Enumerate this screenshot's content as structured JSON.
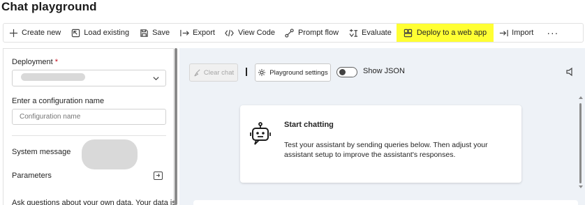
{
  "page": {
    "title": "Chat playground"
  },
  "toolbar": {
    "items": [
      {
        "label": "Create new",
        "icon": "plus-icon"
      },
      {
        "label": "Load existing",
        "icon": "load-icon"
      },
      {
        "label": "Save",
        "icon": "save-icon"
      },
      {
        "label": "Export",
        "icon": "export-icon"
      },
      {
        "label": "View Code",
        "icon": "code-icon"
      },
      {
        "label": "Prompt flow",
        "icon": "flow-icon"
      },
      {
        "label": "Evaluate",
        "icon": "evaluate-icon"
      },
      {
        "label": "Deploy to a web app",
        "icon": "webapp-icon"
      },
      {
        "label": "Import",
        "icon": "import-icon"
      }
    ],
    "more": "···",
    "highlight_color": "#ffff33"
  },
  "setup": {
    "deployment_label": "Deployment",
    "required_mark": "*",
    "config_label": "Enter a configuration name",
    "config_placeholder": "Configuration name",
    "system_message_label": "System message",
    "parameters_label": "Parameters",
    "note_text": "Ask questions about your own data. Your data is"
  },
  "chat": {
    "clear_label": "Clear chat",
    "settings_label": "Playground settings",
    "show_json_label": "Show JSON",
    "start_title": "Start chatting",
    "start_body": "Test your assistant by sending queries below. Then adjust your assistant setup to improve the assistant's responses."
  }
}
